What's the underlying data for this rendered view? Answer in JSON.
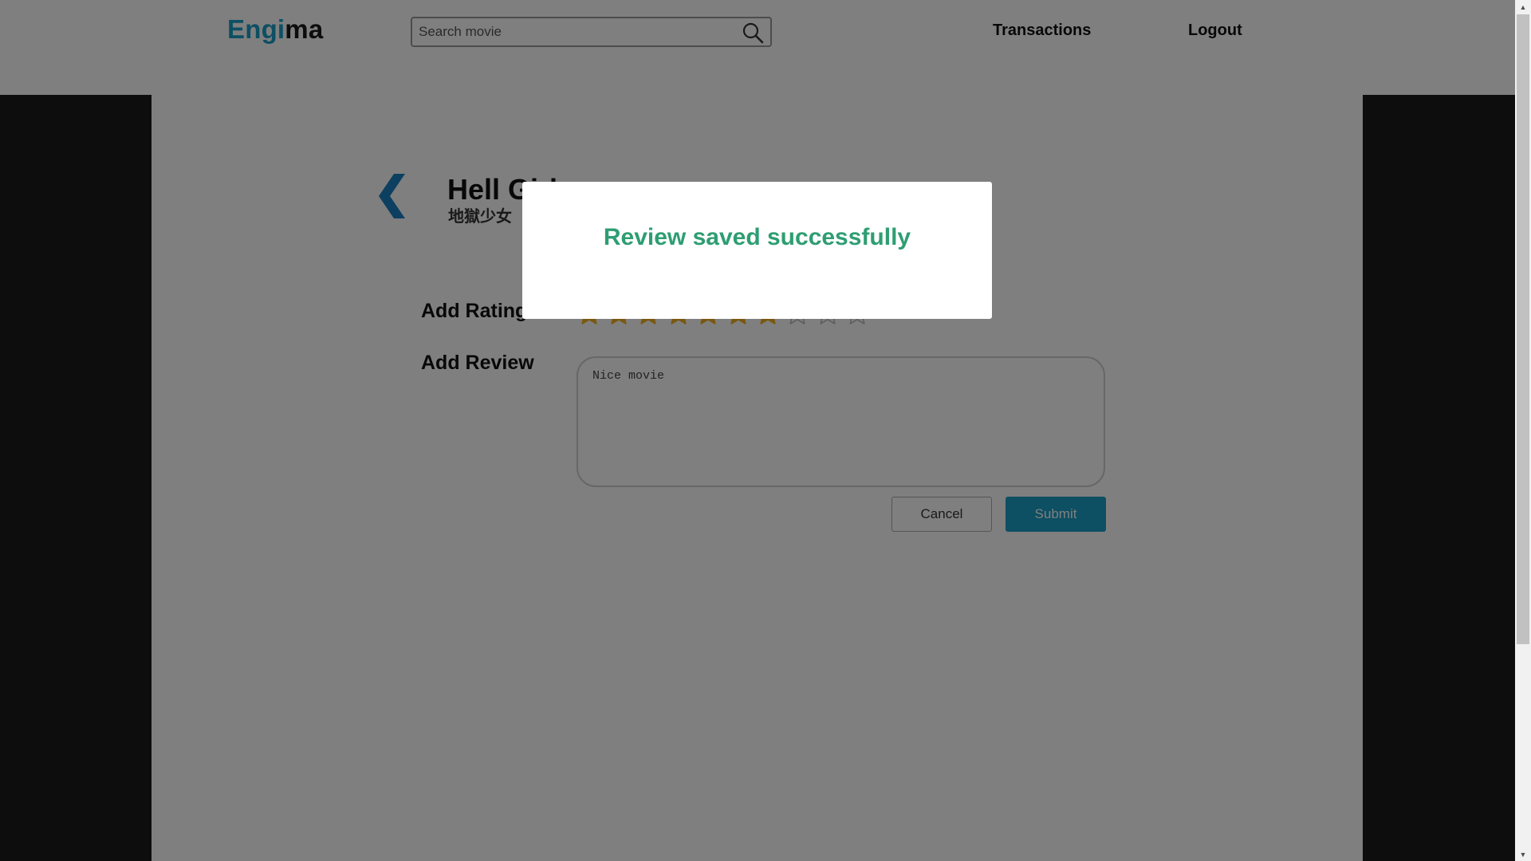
{
  "header": {
    "logo_part1": "Engi",
    "logo_part2": "ma",
    "search_placeholder": "Search movie",
    "nav": {
      "transactions": "Transactions",
      "logout": "Logout"
    }
  },
  "movie": {
    "title": "Hell Girl",
    "subtitle": "地獄少女"
  },
  "form": {
    "rating_label": "Add Rating",
    "rating_value": 7,
    "rating_max": 10,
    "review_label": "Add Review",
    "review_text": "Nice movie",
    "cancel_label": "Cancel",
    "submit_label": "Submit"
  },
  "modal": {
    "message": "Review saved successfully"
  },
  "colors": {
    "accent": "#1a9fc6",
    "success": "#2e9e72",
    "star_filled": "#f2b01e",
    "star_empty": "#bdbdbd"
  },
  "icons": {
    "search": "search-icon",
    "back": "chevron-left-icon",
    "star": "star-icon"
  }
}
